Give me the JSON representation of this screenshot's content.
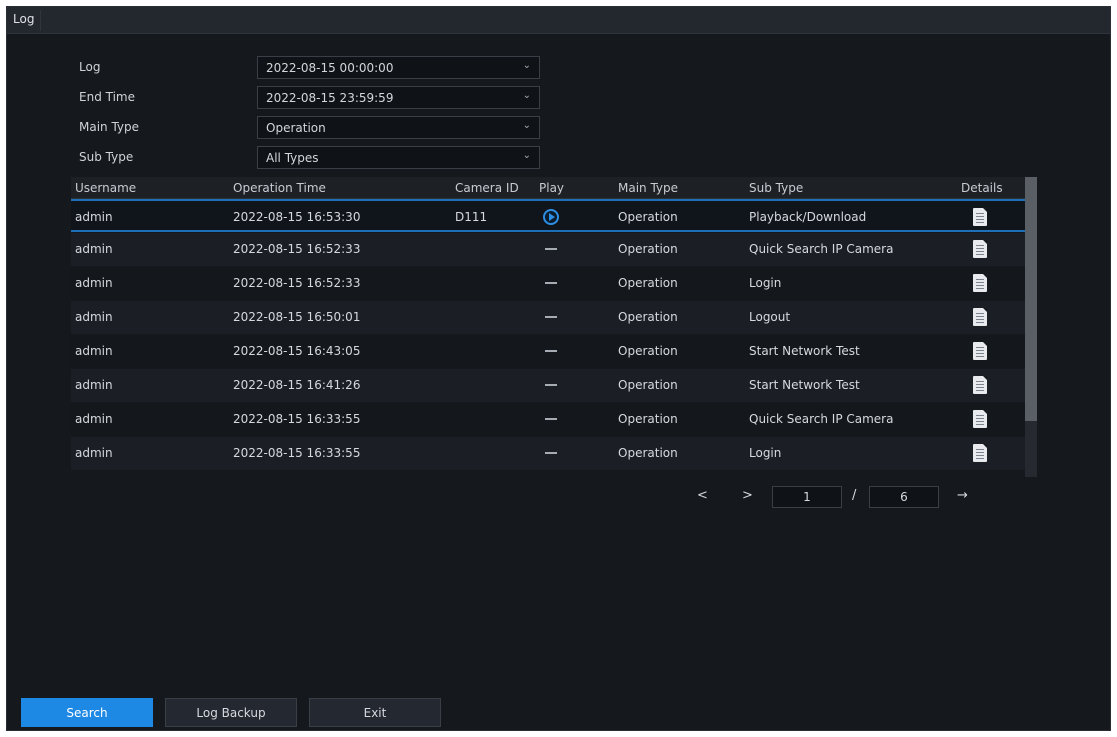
{
  "window": {
    "title": "Log"
  },
  "filters": [
    {
      "label": "Log",
      "value": "2022-08-15 00:00:00"
    },
    {
      "label": "End Time",
      "value": "2022-08-15 23:59:59"
    },
    {
      "label": "Main Type",
      "value": "Operation"
    },
    {
      "label": "Sub Type",
      "value": "All Types"
    }
  ],
  "table": {
    "headers": [
      "Username",
      "Operation Time",
      "Camera ID",
      "Play",
      "Main Type",
      "Sub Type",
      "Details"
    ],
    "rows": [
      {
        "username": "admin",
        "time": "2022-08-15 16:53:30",
        "camera_id": "D111",
        "play": "play-icon",
        "main_type": "Operation",
        "sub_type": "Playback/Download",
        "details": "document-icon"
      },
      {
        "username": "admin",
        "time": "2022-08-15 16:52:33",
        "camera_id": "",
        "play": "—",
        "main_type": "Operation",
        "sub_type": "Quick Search IP Camera",
        "details": "document-icon"
      },
      {
        "username": "admin",
        "time": "2022-08-15 16:52:33",
        "camera_id": "",
        "play": "—",
        "main_type": "Operation",
        "sub_type": "Login",
        "details": "document-icon"
      },
      {
        "username": "admin",
        "time": "2022-08-15 16:50:01",
        "camera_id": "",
        "play": "—",
        "main_type": "Operation",
        "sub_type": "Logout",
        "details": "document-icon"
      },
      {
        "username": "admin",
        "time": "2022-08-15 16:43:05",
        "camera_id": "",
        "play": "—",
        "main_type": "Operation",
        "sub_type": "Start Network Test",
        "details": "document-icon"
      },
      {
        "username": "admin",
        "time": "2022-08-15 16:41:26",
        "camera_id": "",
        "play": "—",
        "main_type": "Operation",
        "sub_type": "Start Network Test",
        "details": "document-icon"
      },
      {
        "username": "admin",
        "time": "2022-08-15 16:33:55",
        "camera_id": "",
        "play": "—",
        "main_type": "Operation",
        "sub_type": "Quick Search IP Camera",
        "details": "document-icon"
      },
      {
        "username": "admin",
        "time": "2022-08-15 16:33:55",
        "camera_id": "",
        "play": "—",
        "main_type": "Operation",
        "sub_type": "Login",
        "details": "document-icon"
      }
    ]
  },
  "pagination": {
    "prev": "<",
    "next": ">",
    "current": "1",
    "separator": "/",
    "total": "6",
    "go": "→"
  },
  "buttons": {
    "search": "Search",
    "backup": "Log Backup",
    "exit": "Exit"
  },
  "colors": {
    "accent": "#1e88e5",
    "play_icon": "#2d8fe3",
    "background": "#15181d"
  }
}
